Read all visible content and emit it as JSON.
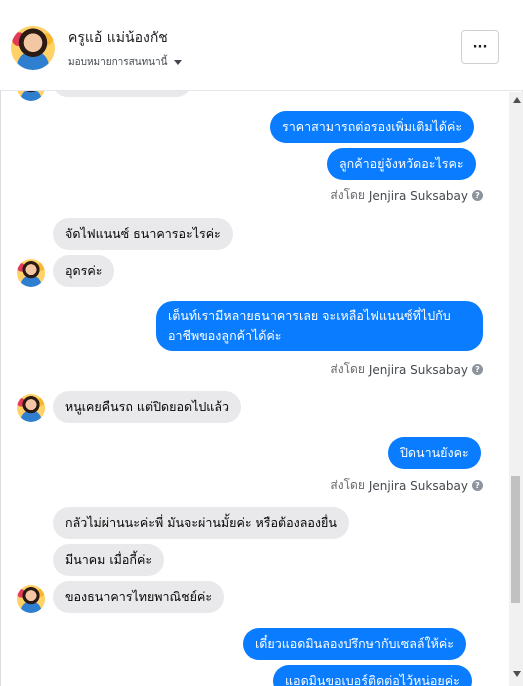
{
  "header": {
    "name": "ครูแอ้ แม่น้องกัช",
    "subtitle": "มอบหมายการสนทนานี้",
    "more_label": "···"
  },
  "messages": {
    "m1": "ราคาสามารถต่อรองเพิ่มเติมได้ค่ะ",
    "m2": "ลูกค้าอยู่จังหวัดอะไรคะ",
    "sent1_prefix": "ส่งโดย",
    "sent1_name": "Jenjira Suksabay",
    "m3": "จัดไฟแนนซ์  ธนาคารอะไรค่ะ",
    "m4": "อุดรค่ะ",
    "m5": "เต็นท์เรามีหลายธนาคารเลย จะเหลือไฟแนนซ์ที่ไปกับอาชีพของลูกค้าได้ค่ะ",
    "sent2_prefix": "ส่งโดย",
    "sent2_name": "Jenjira Suksabay",
    "m6": "หนูเคยคืนรถ   แต่ปิดยอดไปแล้ว",
    "m7": "ปิดนานยังคะ",
    "sent3_prefix": "ส่งโดย",
    "sent3_name": "Jenjira Suksabay",
    "m8": "กลัวไม่ผ่านนะค่ะพี่  มันจะผ่านมั้ยค่ะ  หรือต้องลองยื่น",
    "m9": "มีนาคม เมื่อกี้ค่ะ",
    "m10": "ของธนาคารไทยพาณิชย์ค่ะ",
    "m11": "เดี๋ยวแอดมินลองปรึกษากับเซลล์ให้ค่ะ",
    "m12": "แอดมินขอเบอร์ติดต่อไว้หน่อยค่ะ"
  },
  "colors": {
    "outgoing": "#0a7cff",
    "incoming": "#e9e9eb"
  },
  "icons": {
    "more": "more-horizontal-icon",
    "caret": "caret-down-icon",
    "info": "question-icon"
  }
}
